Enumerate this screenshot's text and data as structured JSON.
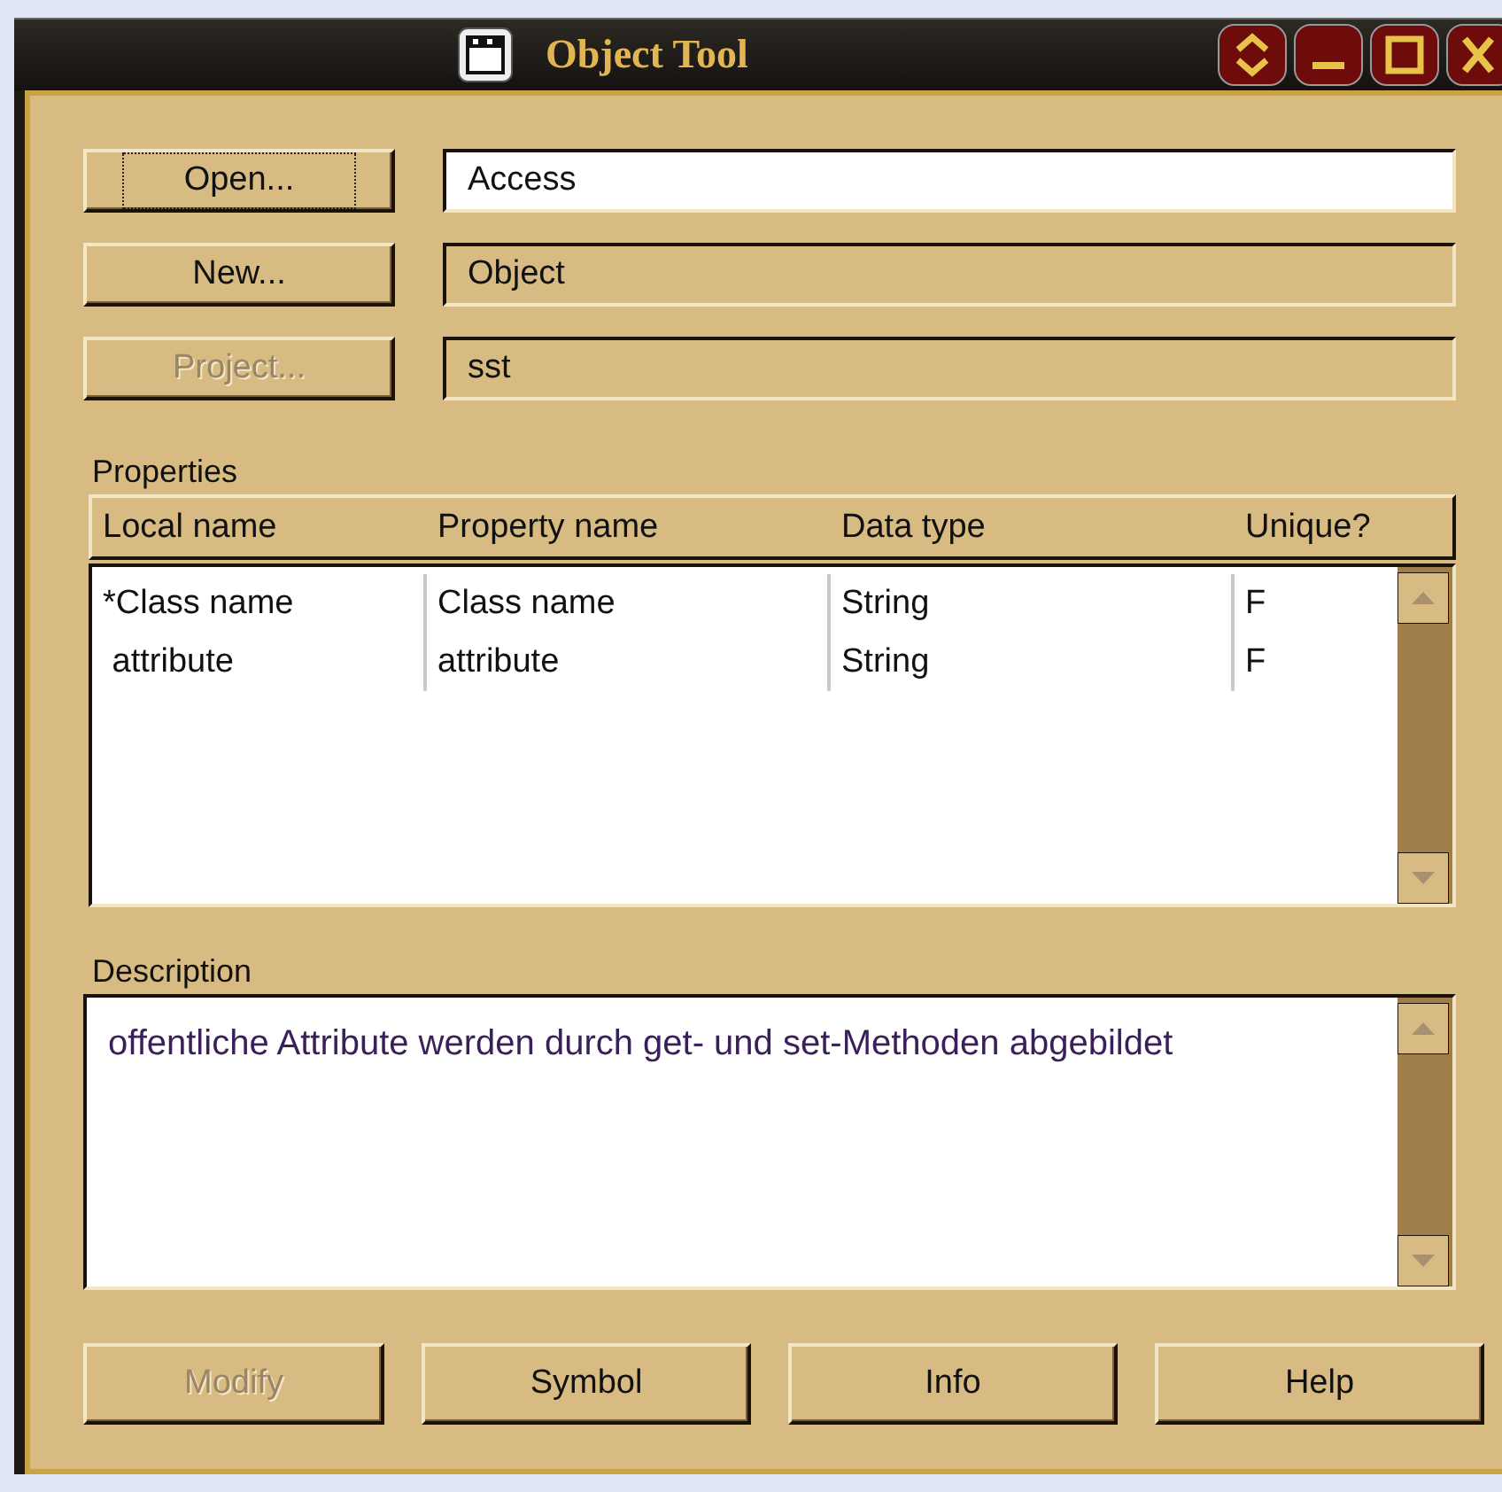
{
  "window": {
    "title": "Object Tool"
  },
  "side_buttons": [
    {
      "label": "Open...",
      "disabled": false,
      "focused": true
    },
    {
      "label": "New...",
      "disabled": false,
      "focused": false
    },
    {
      "label": "Project...",
      "disabled": true,
      "focused": false
    }
  ],
  "fields": [
    {
      "value": "Access",
      "readonly": false
    },
    {
      "value": "Object",
      "readonly": true
    },
    {
      "value": "sst",
      "readonly": true
    }
  ],
  "properties": {
    "label": "Properties",
    "columns": [
      "Local name",
      "Property name",
      "Data type",
      "Unique?"
    ],
    "rows": [
      [
        "*Class name",
        "Class name",
        "String",
        "F"
      ],
      [
        " attribute",
        "attribute",
        "String",
        "F"
      ]
    ]
  },
  "description": {
    "label": "Description",
    "text": "offentliche Attribute werden durch get- und set-Methoden abgebildet"
  },
  "bottom_buttons": [
    {
      "label": "Modify",
      "disabled": true
    },
    {
      "label": "Symbol",
      "disabled": false
    },
    {
      "label": "Info",
      "disabled": false
    },
    {
      "label": "Help",
      "disabled": false
    }
  ]
}
